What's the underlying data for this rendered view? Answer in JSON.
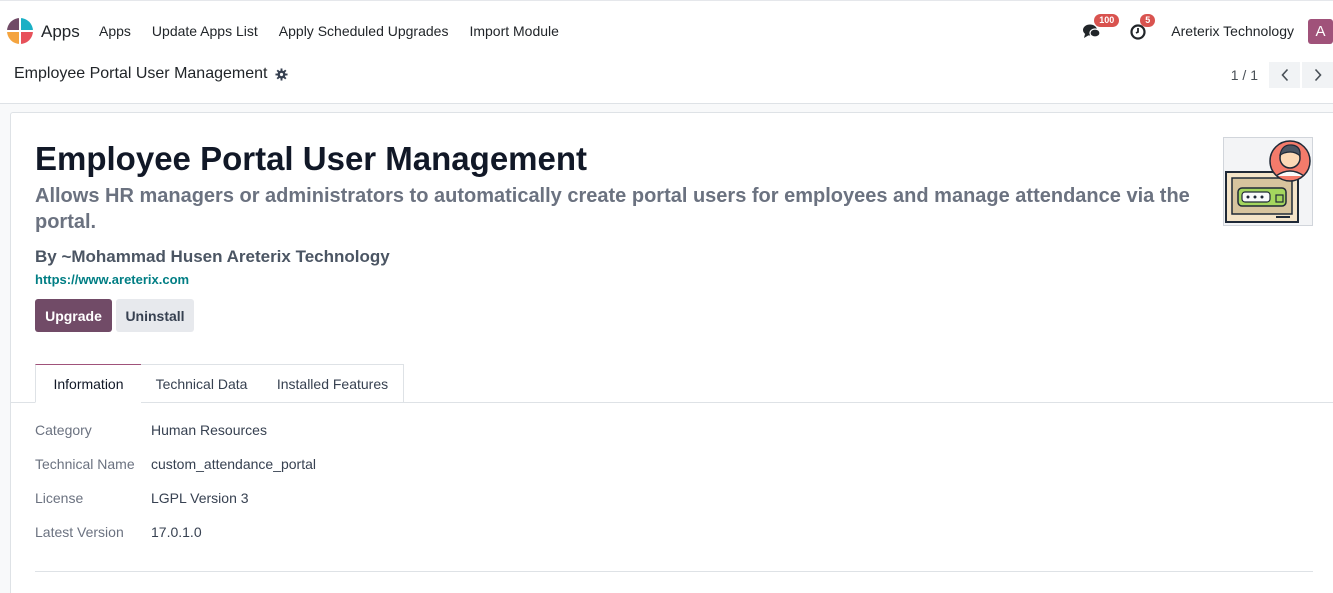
{
  "navbar": {
    "app_name": "Apps",
    "menu": [
      "Apps",
      "Update Apps List",
      "Apply Scheduled Upgrades",
      "Import Module"
    ],
    "messages_count": "100",
    "activities_count": "5",
    "company": "Areterix Technology",
    "avatar_letter": "A"
  },
  "control_panel": {
    "breadcrumb": "Employee Portal User Management",
    "pager": "1 / 1"
  },
  "module": {
    "title": "Employee Portal User Management",
    "summary": "Allows HR managers or administrators to automatically create portal users for employees and manage attendance via the portal.",
    "author": "By ~Mohammad Husen Areterix Technology",
    "website": "https://www.areterix.com",
    "upgrade_label": "Upgrade",
    "uninstall_label": "Uninstall"
  },
  "tabs": [
    {
      "label": "Information",
      "active": true
    },
    {
      "label": "Technical Data",
      "active": false
    },
    {
      "label": "Installed Features",
      "active": false
    }
  ],
  "info_fields": [
    {
      "label": "Category",
      "value": "Human Resources"
    },
    {
      "label": "Technical Name",
      "value": "custom_attendance_portal"
    },
    {
      "label": "License",
      "value": "LGPL Version 3"
    },
    {
      "label": "Latest Version",
      "value": "17.0.1.0"
    }
  ],
  "colors": {
    "brand": "#714b67",
    "link": "#017e84",
    "badge": "#d9534f",
    "avatar": "#a0527a"
  }
}
